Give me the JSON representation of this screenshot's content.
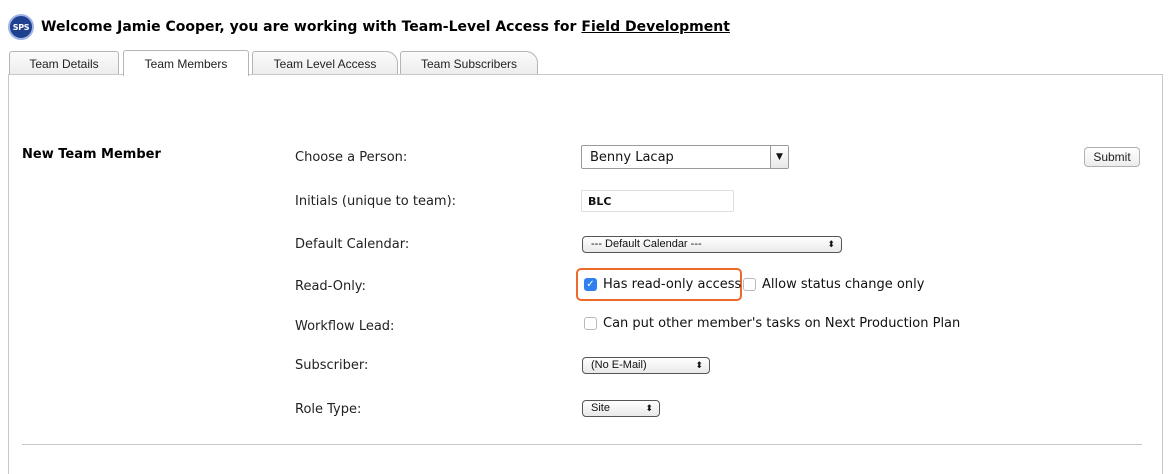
{
  "header": {
    "logo_text": "SPS",
    "welcome_text": "Welcome Jamie Cooper, you are working with Team-Level Access for",
    "team_name": "Field Development"
  },
  "tabs": [
    {
      "label": "Team Details",
      "active": false
    },
    {
      "label": "Team Members",
      "active": true
    },
    {
      "label": "Team Level Access",
      "active": false
    },
    {
      "label": "Team Subscribers",
      "active": false
    }
  ],
  "form": {
    "section_title": "New Team Member",
    "submit_label": "Submit",
    "fields": {
      "person": {
        "label": "Choose a Person:",
        "value": "Benny Lacap"
      },
      "initials": {
        "label": "Initials (unique to team):",
        "value": "BLC"
      },
      "calendar": {
        "label": "Default Calendar:",
        "value": "--- Default Calendar ---"
      },
      "read_only": {
        "label": "Read-Only:",
        "option1": "Has read-only access",
        "option1_checked": true,
        "option2": "Allow status change only",
        "option2_checked": false
      },
      "workflow_lead": {
        "label": "Workflow Lead:",
        "option": "Can put other member's tasks on Next Production Plan",
        "checked": false
      },
      "subscriber": {
        "label": "Subscriber:",
        "value": "(No E-Mail)"
      },
      "role_type": {
        "label": "Role Type:",
        "value": "Site"
      }
    }
  },
  "colors": {
    "highlight": "#ec6a2c",
    "checkbox_checked": "#2f7ff0",
    "logo_bg": "#1f3f8f"
  }
}
